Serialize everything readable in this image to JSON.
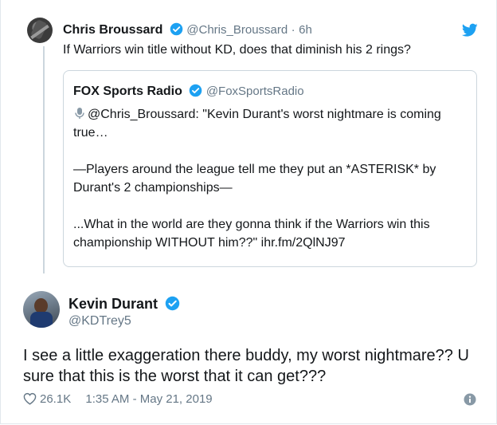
{
  "reply_tweet": {
    "name": "Chris Broussard",
    "handle": "@Chris_Broussard",
    "separator": "·",
    "age": "6h",
    "text": "If Warriors win title without KD, does that diminish his 2 rings?"
  },
  "quoted_tweet": {
    "name": "FOX Sports Radio",
    "handle": "@FoxSportsRadio",
    "paragraphs": [
      "@Chris_Broussard: \"Kevin Durant's worst nightmare is coming true…",
      "—Players around the league tell me they put an *ASTERISK* by Durant's 2 championships—",
      "...What in the world are they gonna think if the Warriors win this championship WITHOUT him??\" ihr.fm/2QlNJ97"
    ],
    "icon": "microphone-icon"
  },
  "main_tweet": {
    "name": "Kevin Durant",
    "handle": "@KDTrey5",
    "text": "I see a little exaggeration there buddy, my worst nightmare?? U sure that this is the worst that it can get???",
    "likes": "26.1K",
    "timestamp": "1:35 AM - May 21, 2019"
  },
  "icons": [
    "verified-badge-icon",
    "twitter-bird-icon",
    "heart-icon",
    "info-icon",
    "microphone-icon"
  ],
  "colors": {
    "twitter_blue": "#1da1f2",
    "text_primary": "#14171a",
    "text_secondary": "#657786",
    "border": "#ccd6dd"
  }
}
